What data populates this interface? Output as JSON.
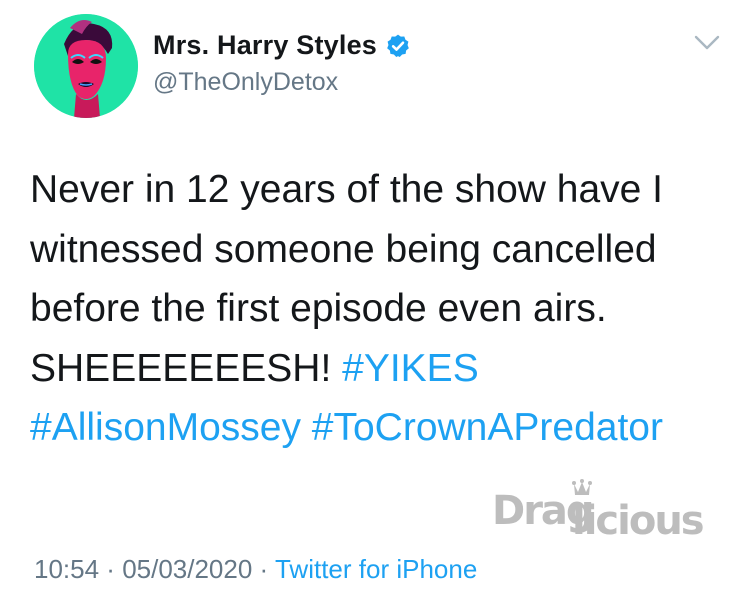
{
  "author": {
    "display_name": "Mrs. Harry Styles",
    "handle": "@TheOnlyDetox",
    "verified": true,
    "avatar_icon": "profile-portrait",
    "verified_icon": "verified-badge-icon",
    "verified_color": "#1da1f2"
  },
  "tweet": {
    "line1": "Never in 12 years of the show have I",
    "line2": "witnessed someone being cancelled",
    "line3": "before the first episode even airs.",
    "line4_text": "SHEEEEEEESH! ",
    "hashtag1": "#YIKES",
    "hashtag2": "#AllisonMossey",
    "hashtag3": "#ToCrownAPredator"
  },
  "meta": {
    "time": "10:54",
    "separator1": " · ",
    "date": "05/03/2020",
    "separator2": " · ",
    "source": "Twitter for iPhone"
  },
  "watermark": {
    "text_part1": "Drag",
    "text_part2": "licious"
  },
  "colors": {
    "text_primary": "#14171a",
    "text_secondary": "#657786",
    "accent": "#1da1f2"
  }
}
